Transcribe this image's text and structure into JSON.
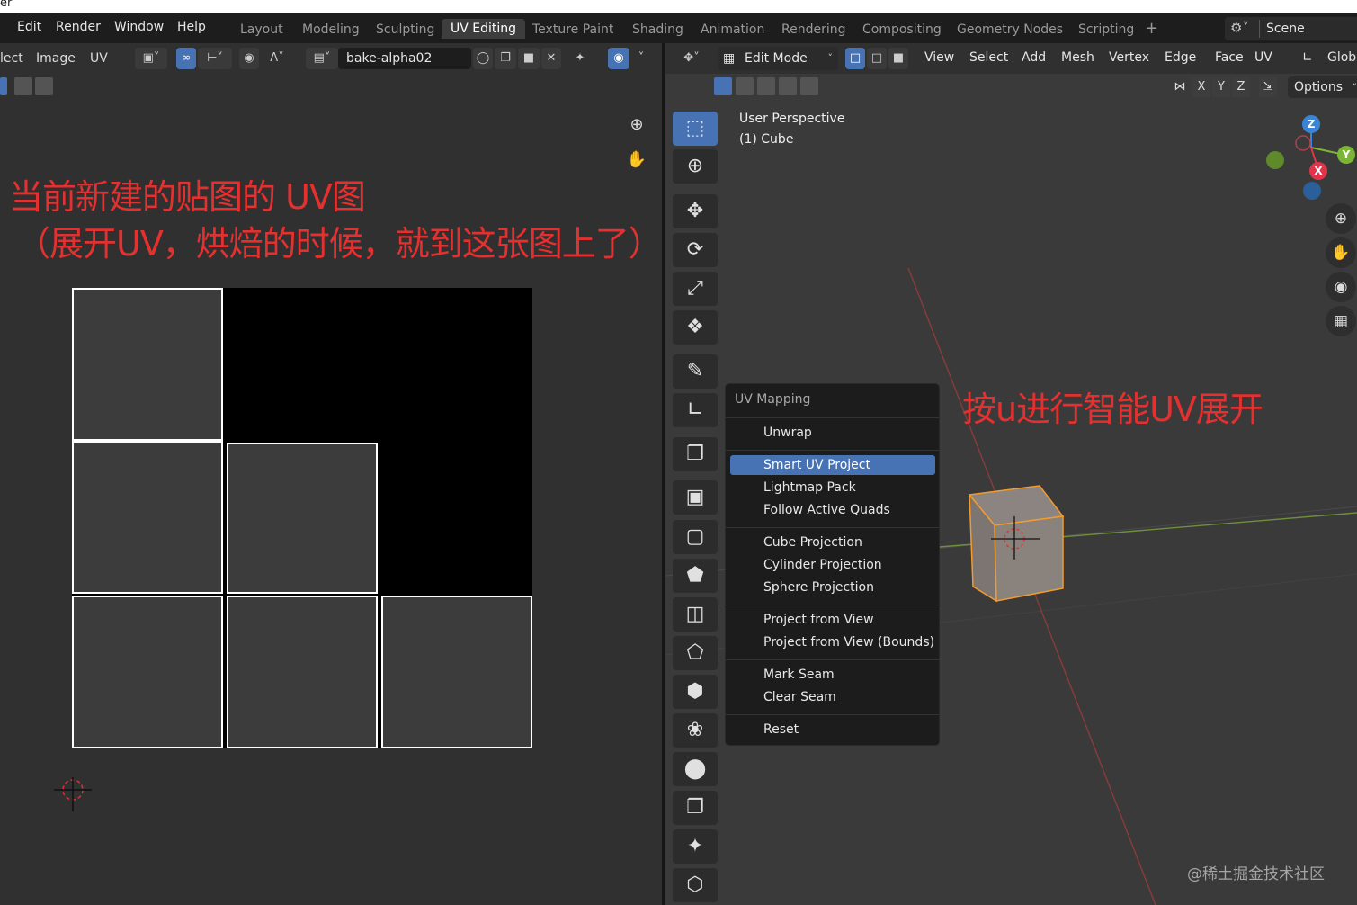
{
  "titlebar": {
    "text": "er"
  },
  "top_menu": [
    "Edit",
    "Render",
    "Window",
    "Help"
  ],
  "workspaces": [
    "Layout",
    "Modeling",
    "Sculpting",
    "UV Editing",
    "Texture Paint",
    "Shading",
    "Animation",
    "Rendering",
    "Compositing",
    "Geometry Nodes",
    "Scripting"
  ],
  "active_workspace": "UV Editing",
  "add_workspace": "+",
  "scene": {
    "label": "Scene"
  },
  "uv_editor": {
    "menu": [
      "lect",
      "Image",
      "UV"
    ],
    "image_name": "bake-alpha02",
    "annotation_line1": "当前新建的贴图的 UV图",
    "annotation_line2": "（展开UV，烘焙的时候，就到这张图上了）"
  },
  "viewport": {
    "mode": "Edit Mode",
    "menu": [
      "View",
      "Select",
      "Add",
      "Mesh",
      "Vertex",
      "Edge",
      "Face",
      "UV"
    ],
    "global_label": "Globa",
    "axes": [
      "X",
      "Y",
      "Z"
    ],
    "options_label": "Options",
    "perspective": "User Perspective",
    "object": "(1) Cube",
    "annotation": "按u进行智能UV展开"
  },
  "uv_popup": {
    "title": "UV Mapping",
    "groups": [
      [
        "Unwrap"
      ],
      [
        "Smart UV Project",
        "Lightmap Pack",
        "Follow Active Quads"
      ],
      [
        "Cube Projection",
        "Cylinder Projection",
        "Sphere Projection"
      ],
      [
        "Project from View",
        "Project from View (Bounds)"
      ],
      [
        "Mark Seam",
        "Clear Seam"
      ],
      [
        "Reset"
      ]
    ],
    "highlighted": "Smart UV Project"
  },
  "gizmo": {
    "z": "Z",
    "y": "Y",
    "x": "X"
  },
  "watermark": "@稀土掘金技术社区",
  "colors": {
    "accent": "#4772b3",
    "annotation": "#e53030",
    "background": "#303030",
    "x_axis": "#e0344a",
    "y_axis": "#7ab535",
    "z_axis": "#3a85d6"
  }
}
